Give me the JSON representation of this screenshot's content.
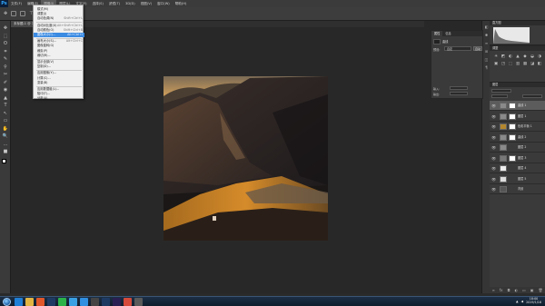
{
  "app": {
    "logo_text": "Ps"
  },
  "menubar": {
    "items": [
      "文件(F)",
      "编辑(E)",
      "图像(I)",
      "图层(L)",
      "文字(Y)",
      "选择(S)",
      "滤镜(T)",
      "3D(D)",
      "视图(V)",
      "窗口(W)",
      "帮助(H)"
    ],
    "active_index": 2
  },
  "document": {
    "tab_title": "未标题-1 @ 33.3% (曲线 1, 图层蒙版/8)"
  },
  "image_menu": {
    "items": [
      {
        "label": "模式(M)",
        "shortcut": "",
        "highlight": false
      },
      {
        "label": "调整(J)",
        "shortcut": "",
        "highlight": false
      },
      {
        "label": "自动色调(N)",
        "shortcut": "Shift+Ctrl+L",
        "highlight": false
      },
      {
        "label": "自动对比度(U)",
        "shortcut": "Alt+Shift+Ctrl+L",
        "highlight": false
      },
      {
        "label": "自动颜色(O)",
        "shortcut": "Shift+Ctrl+B",
        "highlight": false
      },
      {
        "label": "图像大小(I)...",
        "shortcut": "Alt+Ctrl+I",
        "highlight": true
      },
      {
        "label": "画布大小(S)...",
        "shortcut": "Alt+Ctrl+C",
        "highlight": false
      },
      {
        "label": "图像旋转(G)",
        "shortcut": "",
        "highlight": false
      },
      {
        "label": "裁剪(P)",
        "shortcut": "",
        "highlight": false
      },
      {
        "label": "裁切(R)...",
        "shortcut": "",
        "highlight": false
      },
      {
        "label": "显示全部(V)",
        "shortcut": "",
        "highlight": false
      },
      {
        "label": "复制(D)...",
        "shortcut": "",
        "highlight": false
      },
      {
        "label": "应用图像(Y)...",
        "shortcut": "",
        "highlight": false
      },
      {
        "label": "计算(C)...",
        "shortcut": "",
        "highlight": false
      },
      {
        "label": "变量(B)",
        "shortcut": "",
        "highlight": false
      },
      {
        "label": "应用数据组(L)...",
        "shortcut": "",
        "highlight": false
      },
      {
        "label": "陷印(T)...",
        "shortcut": "",
        "highlight": false
      },
      {
        "label": "分析(A)",
        "shortcut": "",
        "highlight": false
      }
    ]
  },
  "properties": {
    "tabs": [
      "属性",
      "信息"
    ],
    "adjust_label": "曲线",
    "preset_label": "预设:",
    "preset_value": "自定",
    "auto_label": "自动",
    "input_label": "输入:",
    "output_label": "输出:"
  },
  "histogram": {
    "title": "直方图"
  },
  "adjustments": {
    "title": "调整"
  },
  "layers": {
    "title": "图层",
    "rows": [
      {
        "name": "曲线 1",
        "thumb": "#8a8a8a",
        "mask": true,
        "selected": true
      },
      {
        "name": "图层 1",
        "thumb": "#8a8a8a",
        "mask": true,
        "selected": false
      },
      {
        "name": "色彩平衡 1",
        "thumb": "#b4872e",
        "mask": true,
        "selected": false
      },
      {
        "name": "曲线 2",
        "thumb": "#8a8a8a",
        "mask": true,
        "selected": false
      },
      {
        "name": "图层 2",
        "thumb": "#8a8a8a",
        "mask": false,
        "selected": false
      },
      {
        "name": "图层 3",
        "thumb": "#777777",
        "mask": true,
        "selected": false
      },
      {
        "name": "图层 4",
        "thumb": "#eeeeee",
        "mask": false,
        "selected": false
      },
      {
        "name": "图层 5",
        "thumb": "#dddddd",
        "mask": false,
        "selected": false
      },
      {
        "name": "背景",
        "thumb": "#555555",
        "mask": false,
        "selected": false
      }
    ]
  },
  "taskbar": {
    "apps": [
      {
        "icon": "ie-icon",
        "color": "#1f7fd6"
      },
      {
        "icon": "folder-icon",
        "color": "#e2b542"
      },
      {
        "icon": "player-icon",
        "color": "#e0572b"
      },
      {
        "icon": "ps-icon",
        "color": "#1d3a63"
      },
      {
        "icon": "wechat-icon",
        "color": "#2bb34a"
      },
      {
        "icon": "qq-icon",
        "color": "#3aa0e4"
      },
      {
        "icon": "browser-icon",
        "color": "#2f8fe0"
      },
      {
        "icon": "app-icon",
        "color": "#444444"
      },
      {
        "icon": "ps2-icon",
        "color": "#1d3a63"
      },
      {
        "icon": "pr-icon",
        "color": "#2a1f52"
      },
      {
        "icon": "chrome-icon",
        "color": "#d54a3a"
      },
      {
        "icon": "app2-icon",
        "color": "#5a5a5a"
      }
    ],
    "time": "18:00",
    "date": "2019/1/16"
  }
}
